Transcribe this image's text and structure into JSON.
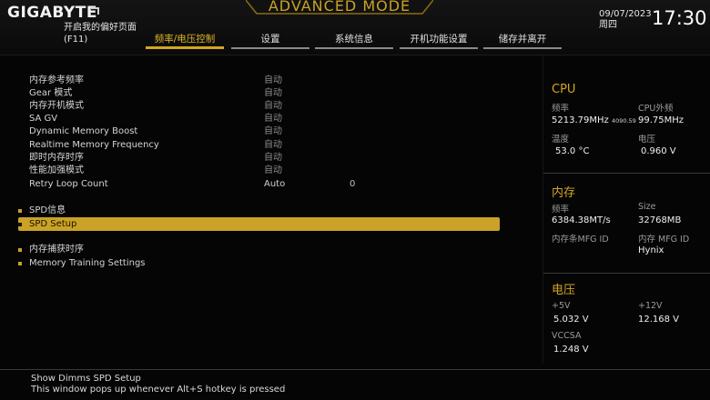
{
  "header": {
    "brand": "GIGABYTE",
    "favorites_line1": "开启我的偏好页面",
    "favorites_line2": "(F11)",
    "mode": "ADVANCED MODE",
    "date": "09/07/2023",
    "weekday": "周四",
    "time": "17:30",
    "tabs": [
      {
        "label": "频率/电压控制",
        "active": true
      },
      {
        "label": "设置",
        "active": false
      },
      {
        "label": "系统信息",
        "active": false
      },
      {
        "label": "开机功能设置",
        "active": false
      },
      {
        "label": "储存并离开",
        "active": false
      }
    ]
  },
  "settings": [
    {
      "label": "内存参考频率",
      "value": "自动"
    },
    {
      "label": "Gear 模式",
      "value": "自动"
    },
    {
      "label": "内存开机模式",
      "value": "自动"
    },
    {
      "label": "SA GV",
      "value": "自动"
    },
    {
      "label": "Dynamic Memory Boost",
      "value": "自动"
    },
    {
      "label": "Realtime Memory Frequency",
      "value": "自动"
    },
    {
      "label": "即时内存时序",
      "value": "自动"
    },
    {
      "label": "性能加强模式",
      "value": "自动"
    },
    {
      "label": "Retry Loop Count",
      "value": "Auto",
      "value2": "0"
    }
  ],
  "menus": [
    {
      "label": "SPD信息",
      "selected": false
    },
    {
      "label": "SPD Setup",
      "selected": true
    },
    {
      "label": "内存捕获时序",
      "selected": false
    },
    {
      "label": "Memory Training Settings",
      "selected": false
    }
  ],
  "cpu": {
    "title": "CPU",
    "freq_label": "频率",
    "freq_value": "5213.79MHz",
    "freq_small": "4090.59",
    "bclk_label": "CPU外频",
    "bclk_value": "99.75MHz",
    "temp_label": "温度",
    "temp_value": "53.0 °C",
    "volt_label": "电压",
    "volt_value": "0.960 V"
  },
  "memory": {
    "title": "内存",
    "freq_label": "频率",
    "freq_value": "6384.38MT/s",
    "size_label": "Size",
    "size_value": "32768MB",
    "mfg_label": "内存条MFG ID",
    "chip_label": "内存 MFG ID",
    "chip_value": "Hynix"
  },
  "voltage": {
    "title": "电压",
    "p5_label": "+5V",
    "p5_value": "5.032 V",
    "p12_label": "+12V",
    "p12_value": "12.168 V",
    "vccsa_label": "VCCSA",
    "vccsa_value": "1.248 V"
  },
  "help": {
    "line1": "Show Dimms SPD Setup",
    "line2": "This window pops up whenever Alt+S hotkey is pressed"
  },
  "colors": {
    "accent": "#d4a620",
    "background": "#050505"
  }
}
